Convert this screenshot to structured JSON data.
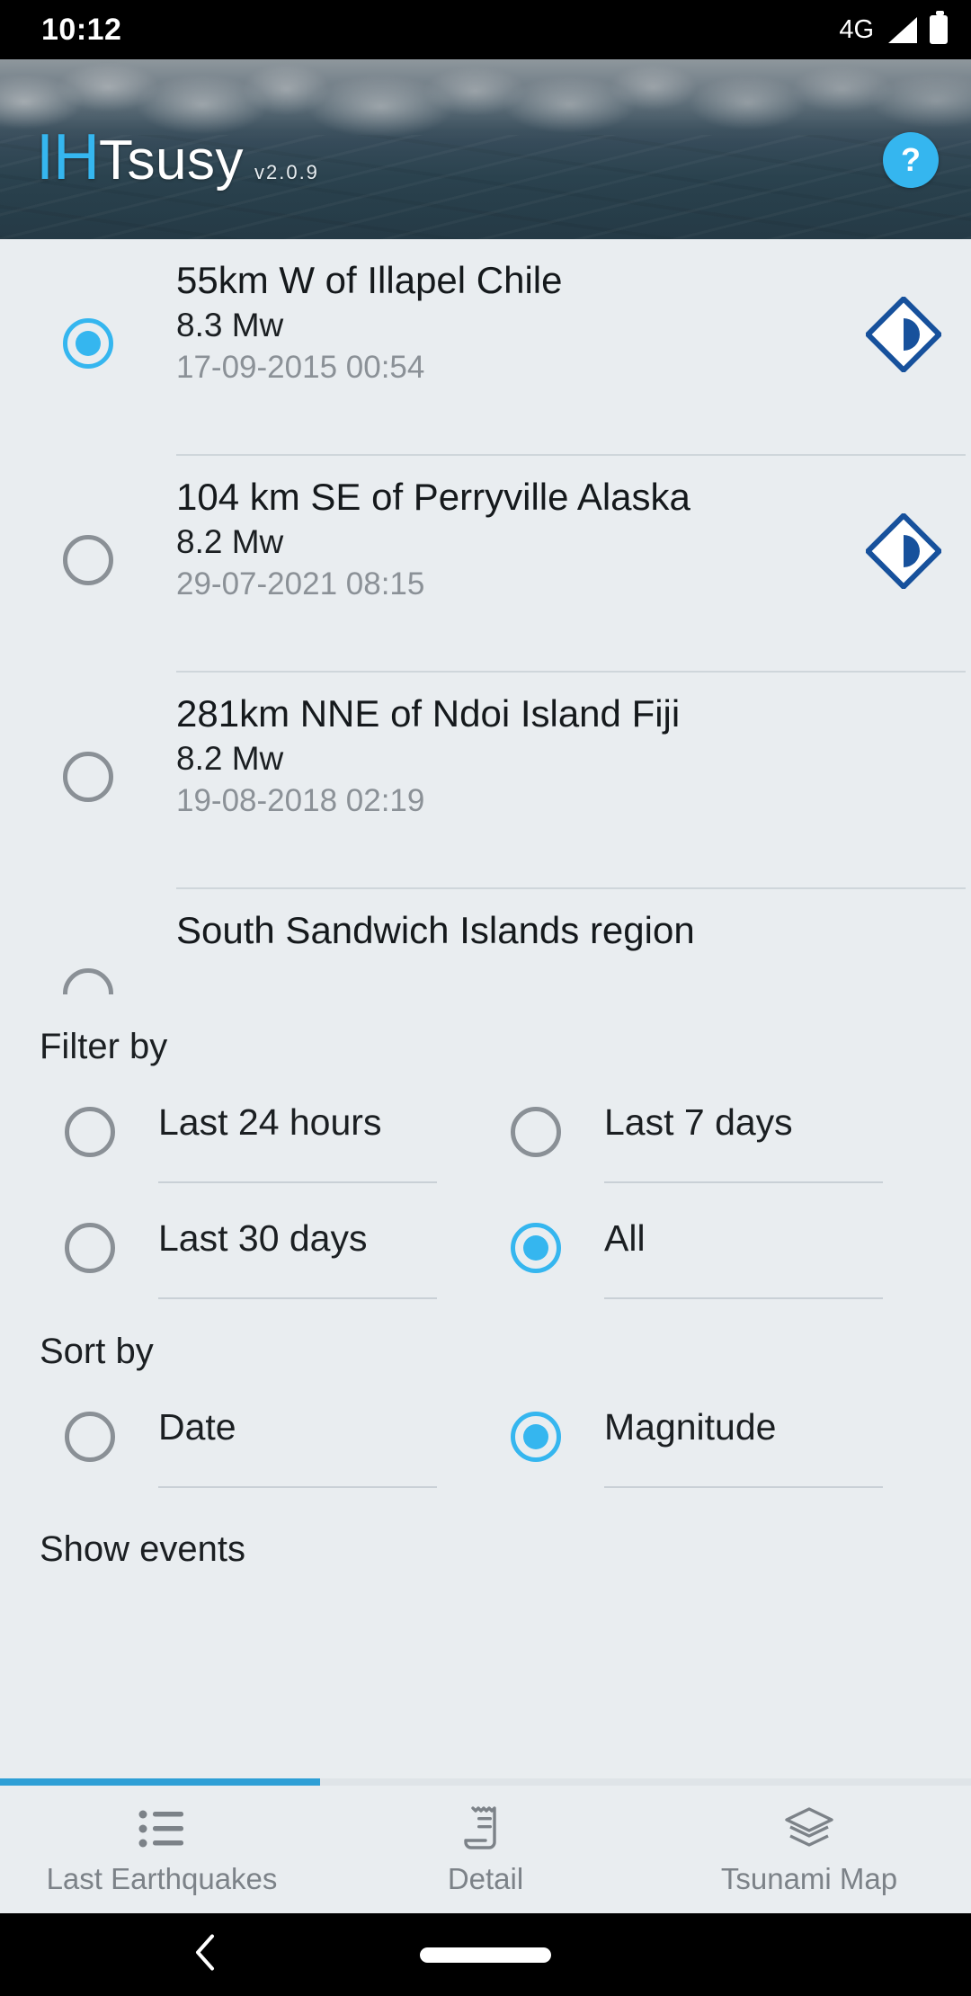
{
  "statusbar": {
    "time": "10:12",
    "network": "4G",
    "signal_icon": "signal-bars-icon",
    "battery_icon": "battery-full-icon"
  },
  "header": {
    "logo_accent": "IH",
    "logo_rest": "Tsusy",
    "version": "v2.0.9",
    "help_label": "?",
    "accent_color": "#35b6ef",
    "background_image": "ocean-wave-photo"
  },
  "earthquakes": {
    "items": [
      {
        "title": "55km W of Illapel Chile",
        "magnitude": "8.3 Mw",
        "date": "17-09-2015 00:54",
        "selected": true,
        "icon": "tsunami-diamond-icon"
      },
      {
        "title": "104 km SE of Perryville Alaska",
        "magnitude": "8.2 Mw",
        "date": "29-07-2021 08:15",
        "selected": false,
        "icon": "tsunami-diamond-icon"
      },
      {
        "title": "281km NNE of Ndoi Island Fiji",
        "magnitude": "8.2 Mw",
        "date": "19-08-2018 02:19",
        "selected": false,
        "icon": ""
      },
      {
        "title": "South Sandwich Islands region",
        "magnitude": "",
        "date": "",
        "selected": false,
        "icon": ""
      }
    ]
  },
  "filter": {
    "heading": "Filter by",
    "options": [
      {
        "label": "Last 24 hours",
        "selected": false
      },
      {
        "label": "Last 7 days",
        "selected": false
      },
      {
        "label": "Last 30 days",
        "selected": false
      },
      {
        "label": "All",
        "selected": true
      }
    ]
  },
  "sort": {
    "heading": "Sort by",
    "options": [
      {
        "label": "Date",
        "selected": false
      },
      {
        "label": "Magnitude",
        "selected": true
      }
    ]
  },
  "actions": {
    "show_events": "Show events"
  },
  "progress": {
    "fill_percent": 33,
    "color": "#2e9fd6"
  },
  "bottom_nav": {
    "items": [
      {
        "label": "Last Earthquakes",
        "icon": "list-bullets-icon",
        "active": true
      },
      {
        "label": "Detail",
        "icon": "receipt-icon",
        "active": false
      },
      {
        "label": "Tsunami Map",
        "icon": "layers-icon",
        "active": false
      }
    ]
  },
  "gesture_bar": {
    "back_icon": "back-chevron-icon",
    "home_pill": "home-pill-icon"
  }
}
